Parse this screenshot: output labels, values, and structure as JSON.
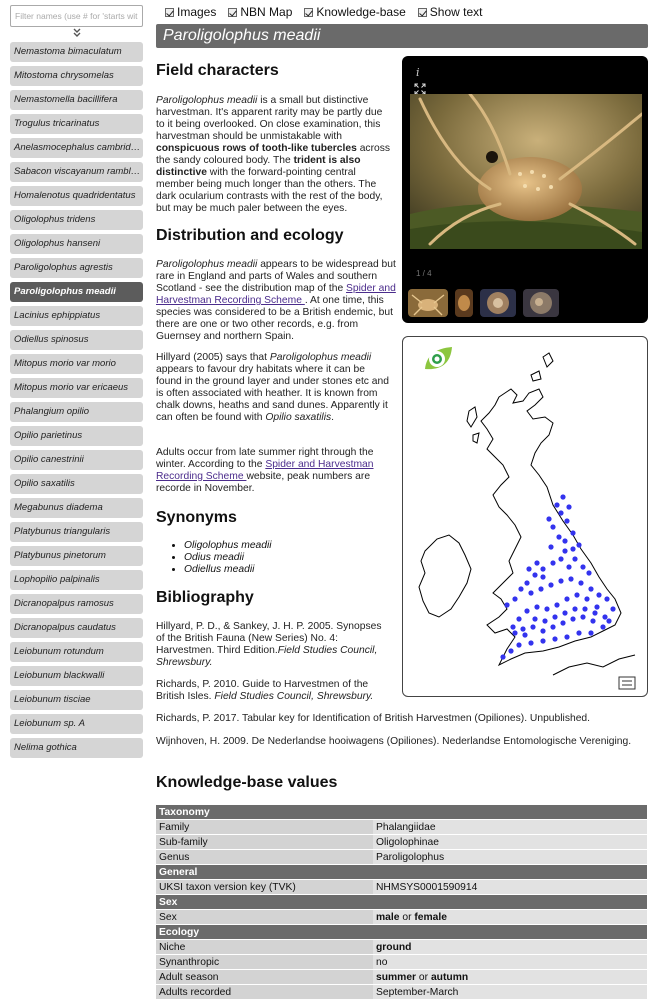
{
  "sidebar": {
    "filter_placeholder": "Filter names (use # for 'starts with')",
    "items": [
      "Nemastoma bimaculatum",
      "Mitostoma chrysomelas",
      "Nemastomella bacillifera",
      "Trogulus tricarinatus",
      "Anelasmocephalus cambridgei",
      "Sabacon viscayanum ramblaianum",
      "Homalenotus quadridentatus",
      "Oligolophus tridens",
      "Oligolophus hanseni",
      "Paroligolophus agrestis",
      "Paroligolophus meadii",
      "Lacinius ephippiatus",
      "Odiellus spinosus",
      "Mitopus morio var morio",
      "Mitopus morio var ericaeus",
      "Phalangium opilio",
      "Opilio parietinus",
      "Opilio canestrinii",
      "Opilio saxatilis",
      "Megabunus diadema",
      "Platybunus triangularis",
      "Platybunus pinetorum",
      "Lophopilio palpinalis",
      "Dicranopalpus ramosus",
      "Dicranopalpus caudatus",
      "Leiobunum rotundum",
      "Leiobunum blackwalli",
      "Leiobunum tisciae",
      "Leiobunum sp. A",
      "Nelima gothica"
    ],
    "selected_index": 10
  },
  "toggles": [
    "Images",
    "NBN Map",
    "Knowledge-base",
    "Show text"
  ],
  "title": "Paroligolophus meadii",
  "sections": {
    "field": "Field characters",
    "distribution": "Distribution and ecology",
    "synonyms": "Synonyms",
    "bibliography": "Bibliography",
    "kb": "Knowledge-base values"
  },
  "field": {
    "name": "Paroligolophus meadii",
    "t1": " is a small but distinctive harvestman. It's apparent rarity may be partly due to it being overlooked. On close examination, this harvestman should be unmistakable with ",
    "b1": "conspicuous rows of tooth-like tubercles",
    "t2": " across the sandy coloured body. The ",
    "b2": "trident is also distinctive",
    "t3": " with the forward-pointing central member being much longer than the others. The dark ocularium contrasts with the rest of the body, but may be much paler between the eyes."
  },
  "dist": {
    "p1_name": "Paroligolophus meadii",
    "p1_t1": " appears to be widespread but rare in England and parts of Wales and southern Scotland - see the distribution map of the ",
    "p1_link": "Spider and Harvestman Recording Scheme ",
    "p1_t2": ". At one time, this species was considered to be a British endemic, but there are one or two other records, e.g. from Guernsey and northern Spain.",
    "p2_t1": "Hillyard (2005) says that ",
    "p2_name": "Paroligolophus meadii",
    "p2_t2": " appears to favour dry habitats where it can be found in the ground layer and under stones etc and is often associated with heather. It is known from chalk downs, heaths and sand dunes. Apparently it can often be found with ",
    "p2_name2": "Opilio saxatilis",
    "p2_t3": ".",
    "p3_t1": "Adults occur from late summer right through the winter. According to the ",
    "p3_link": "Spider and Harvestman Recording Scheme ",
    "p3_t2": "website, peak numbers are recorde in November."
  },
  "synonyms": [
    "Oligolophus meadii",
    "Odius meadii",
    "Odiellus meadii"
  ],
  "bib": {
    "b1_t1": "Hillyard, P. D., & Sankey, J. H. P. 2005. Synopses of the British Fauna (New Series) No. 4: Harvestmen. Third Edition.",
    "b1_i": "Field Studies Council, Shrewsbury.",
    "b2_t1": "Richards, P. 2010. Guide to Harvestmen of the British Isles. ",
    "b2_i": "Field Studies Council, Shrewsbury.",
    "b3": "Richards, P. 2017. Tabular key for Identification of British Harvestmen (Opiliones). Unpublished.",
    "b4": "Wijnhoven, H. 2009. De Nederlandse hooiwagens (Opiliones). Nederlandse Entomologische Vereniging."
  },
  "viewer": {
    "info": "i",
    "counter": "1 / 4"
  },
  "kb": {
    "taxonomy": "Taxonomy",
    "family_k": "Family",
    "family_v": "Phalangiidae",
    "subfamily_k": "Sub-family",
    "subfamily_v": "Oligolophinae",
    "genus_k": "Genus",
    "genus_v": "Paroligolophus",
    "general": "General",
    "tvk_k": "UKSI taxon version key (TVK)",
    "tvk_v": "NHMSYS0001590914",
    "sex": "Sex",
    "sex_k": "Sex",
    "sex_v1": "male",
    "sex_or": " or ",
    "sex_v2": "female",
    "ecology": "Ecology",
    "niche_k": "Niche",
    "niche_v": "ground",
    "syn_k": "Synanthropic",
    "syn_v": "no",
    "season_k": "Adult season",
    "season_v1": "summer",
    "season_or": " or ",
    "season_v2": "autumn",
    "recorded_k": "Adults recorded",
    "recorded_v": "September-March"
  }
}
